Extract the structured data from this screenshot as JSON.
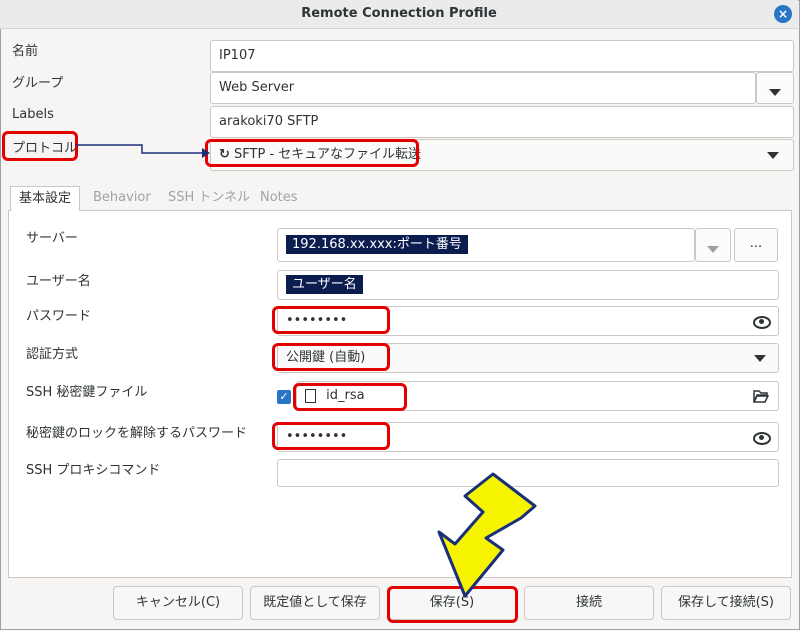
{
  "window": {
    "title": "Remote Connection Profile",
    "close_icon": "×"
  },
  "form": {
    "name_label": "名前",
    "name_value": "IP107",
    "group_label": "グループ",
    "group_value": "Web Server",
    "labels_label": "Labels",
    "labels_value": "arakoki70 SFTP",
    "protocol_label": "プロトコル",
    "protocol_icon": "↻",
    "protocol_value": "SFTP - セキュアなファイル転送"
  },
  "tabs": [
    {
      "label": "基本設定"
    },
    {
      "label": "Behavior"
    },
    {
      "label": "SSH トンネル"
    },
    {
      "label": "Notes"
    }
  ],
  "basic": {
    "server_label": "サーバー",
    "server_value": "192.168.xx.xxx:ポート番号",
    "server_browse": "...",
    "username_label": "ユーザー名",
    "username_value": "ユーザー名",
    "password_label": "パスワード",
    "password_value": "••••••••",
    "auth_label": "認証方式",
    "auth_value": "公開鍵 (自動)",
    "keyfile_label": "SSH 秘密鍵ファイル",
    "keyfile_value": "id_rsa",
    "keypass_label": "秘密鍵のロックを解除するパスワード",
    "keypass_value": "••••••••",
    "proxy_label": "SSH プロキシコマンド",
    "proxy_value": ""
  },
  "buttons": {
    "cancel": "キャンセル(C)",
    "save_default": "既定値として保存",
    "save": "保存(S)",
    "connect": "接続",
    "save_connect": "保存して接続(S)"
  },
  "colors": {
    "annotation_red": "#e30000",
    "annotation_arrow": "#f7f400",
    "highlight_navy": "#0b1d4e",
    "accent_blue": "#2a76c6"
  }
}
